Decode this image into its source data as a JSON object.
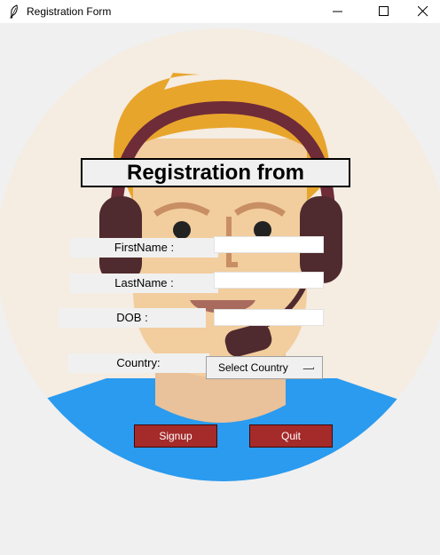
{
  "window": {
    "title": "Registration Form"
  },
  "form": {
    "heading": "Registration from",
    "first_name_label": "FirstName :",
    "last_name_label": "LastName :",
    "dob_label": "DOB :",
    "country_label": "Country:",
    "first_name_value": "",
    "last_name_value": "",
    "dob_value": "",
    "country_selected": "Select Country"
  },
  "buttons": {
    "signup_label": "Signup",
    "quit_label": "Quit"
  },
  "colors": {
    "button_bg": "#a52a2a",
    "background_circle": "#f5ece2",
    "shirt": "#2a9bef",
    "skin": "#f2cd9e",
    "hair": "#e8a52c",
    "headset": "#6e2b38"
  },
  "icons": {
    "app": "feather-icon",
    "minimize": "minimize-icon",
    "maximize": "maximize-icon",
    "close": "close-icon"
  }
}
